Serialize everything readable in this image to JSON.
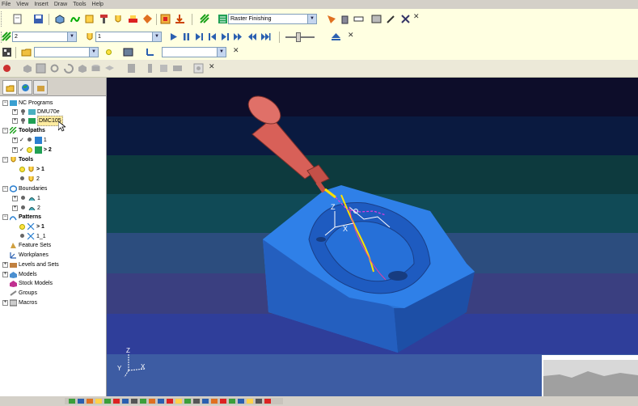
{
  "menu": [
    "File",
    "View",
    "Insert",
    "Draw",
    "Tools",
    "Help"
  ],
  "toolbar1": {
    "strategy_combo": "Raster Finishing"
  },
  "toolbar2": {
    "combo_a": "2",
    "combo_b": "1"
  },
  "tree": {
    "nc_programs": {
      "label": "NC Programs",
      "items": [
        "DMU70e",
        "DMC105"
      ]
    },
    "toolpaths": {
      "label": "Toolpaths",
      "items": [
        "1",
        "> 2"
      ]
    },
    "tools": {
      "label": "Tools",
      "items": [
        "> 1",
        "2"
      ]
    },
    "boundaries": {
      "label": "Boundaries",
      "items": [
        "1",
        "2"
      ]
    },
    "patterns": {
      "label": "Patterns",
      "items": [
        "> 1",
        "1_1"
      ]
    },
    "feature_sets": "Feature Sets",
    "workplanes": "Workplanes",
    "levels": "Levels and Sets",
    "models": "Models",
    "stock_models": "Stock Models",
    "groups": "Groups",
    "macros": "Macros"
  },
  "axes": {
    "z": "Z",
    "y": "Y",
    "x": "X"
  },
  "colors": {
    "toolbar_bg": "#ffffe1",
    "viewport_bands": [
      "#0d0d2a",
      "#0a1a40",
      "#0d3a3e",
      "#104a56",
      "#2c4d7e",
      "#3a3f80",
      "#2f3e9a",
      "#3d5ca3",
      "#3f78c7"
    ],
    "part": "#2a73d6",
    "spindle": "#d86058"
  }
}
